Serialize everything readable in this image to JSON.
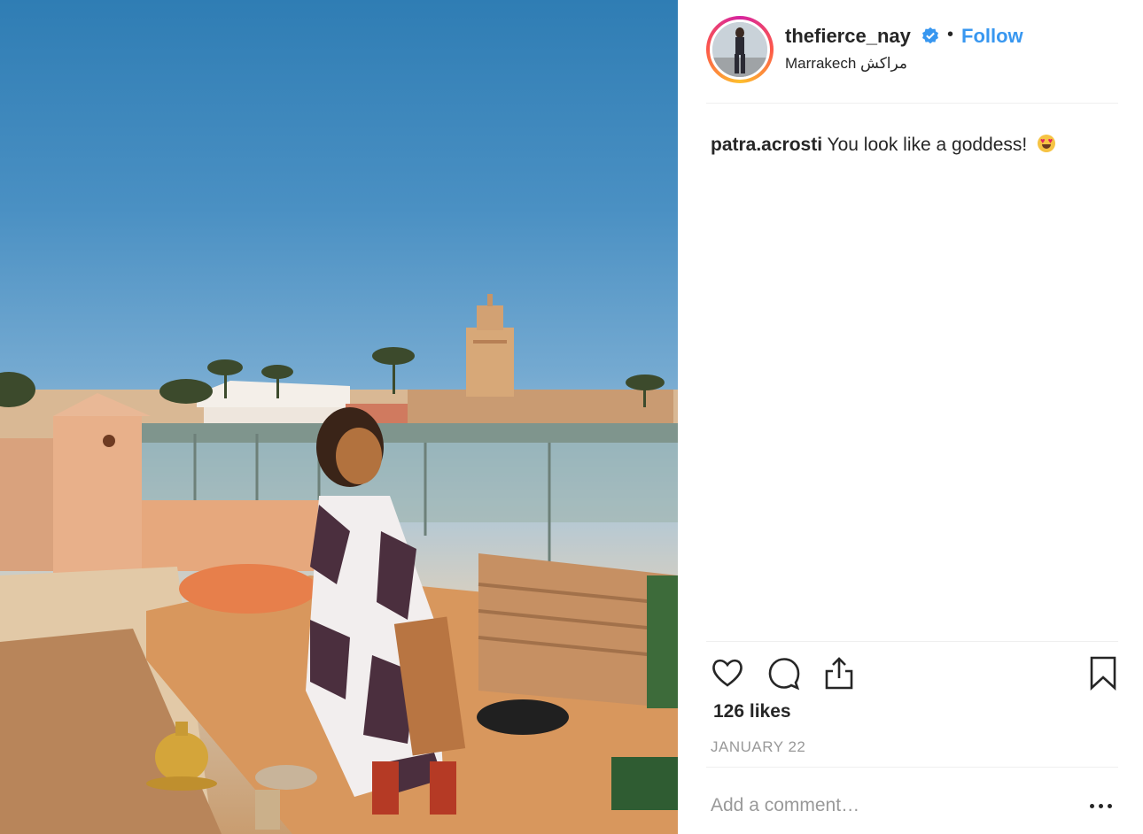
{
  "post": {
    "image_description": "",
    "likes_text": "126 likes",
    "date_text": "JANUARY 22"
  },
  "header": {
    "username": "thefierce_nay",
    "separator": "•",
    "follow_label": "Follow",
    "location": "Marrakech مراكش",
    "verified_icon": "verified-badge-icon"
  },
  "comments": [
    {
      "user": "patra.acrosti",
      "text": "You look like a goddess!",
      "emoji": "heart-eyes-emoji"
    }
  ],
  "actions": {
    "icons": [
      "heart-icon",
      "comment-icon",
      "share-icon",
      "bookmark-icon"
    ]
  },
  "composer": {
    "placeholder": "Add a comment…",
    "more_icon": "more-options-icon"
  },
  "colors": {
    "accent": "#3897f0",
    "text": "#262626",
    "muted": "#999999",
    "divider": "#efefef"
  }
}
